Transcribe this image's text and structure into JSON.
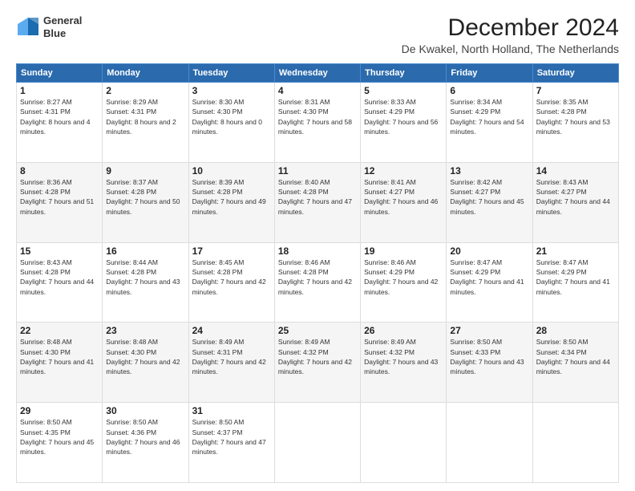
{
  "logo": {
    "line1": "General",
    "line2": "Blue"
  },
  "title": "December 2024",
  "subtitle": "De Kwakel, North Holland, The Netherlands",
  "days_header": [
    "Sunday",
    "Monday",
    "Tuesday",
    "Wednesday",
    "Thursday",
    "Friday",
    "Saturday"
  ],
  "weeks": [
    [
      {
        "day": "1",
        "sunrise": "8:27 AM",
        "sunset": "4:31 PM",
        "daylight": "8 hours and 4 minutes."
      },
      {
        "day": "2",
        "sunrise": "8:29 AM",
        "sunset": "4:31 PM",
        "daylight": "8 hours and 2 minutes."
      },
      {
        "day": "3",
        "sunrise": "8:30 AM",
        "sunset": "4:30 PM",
        "daylight": "8 hours and 0 minutes."
      },
      {
        "day": "4",
        "sunrise": "8:31 AM",
        "sunset": "4:30 PM",
        "daylight": "7 hours and 58 minutes."
      },
      {
        "day": "5",
        "sunrise": "8:33 AM",
        "sunset": "4:29 PM",
        "daylight": "7 hours and 56 minutes."
      },
      {
        "day": "6",
        "sunrise": "8:34 AM",
        "sunset": "4:29 PM",
        "daylight": "7 hours and 54 minutes."
      },
      {
        "day": "7",
        "sunrise": "8:35 AM",
        "sunset": "4:28 PM",
        "daylight": "7 hours and 53 minutes."
      }
    ],
    [
      {
        "day": "8",
        "sunrise": "8:36 AM",
        "sunset": "4:28 PM",
        "daylight": "7 hours and 51 minutes."
      },
      {
        "day": "9",
        "sunrise": "8:37 AM",
        "sunset": "4:28 PM",
        "daylight": "7 hours and 50 minutes."
      },
      {
        "day": "10",
        "sunrise": "8:39 AM",
        "sunset": "4:28 PM",
        "daylight": "7 hours and 49 minutes."
      },
      {
        "day": "11",
        "sunrise": "8:40 AM",
        "sunset": "4:28 PM",
        "daylight": "7 hours and 47 minutes."
      },
      {
        "day": "12",
        "sunrise": "8:41 AM",
        "sunset": "4:27 PM",
        "daylight": "7 hours and 46 minutes."
      },
      {
        "day": "13",
        "sunrise": "8:42 AM",
        "sunset": "4:27 PM",
        "daylight": "7 hours and 45 minutes."
      },
      {
        "day": "14",
        "sunrise": "8:43 AM",
        "sunset": "4:27 PM",
        "daylight": "7 hours and 44 minutes."
      }
    ],
    [
      {
        "day": "15",
        "sunrise": "8:43 AM",
        "sunset": "4:28 PM",
        "daylight": "7 hours and 44 minutes."
      },
      {
        "day": "16",
        "sunrise": "8:44 AM",
        "sunset": "4:28 PM",
        "daylight": "7 hours and 43 minutes."
      },
      {
        "day": "17",
        "sunrise": "8:45 AM",
        "sunset": "4:28 PM",
        "daylight": "7 hours and 42 minutes."
      },
      {
        "day": "18",
        "sunrise": "8:46 AM",
        "sunset": "4:28 PM",
        "daylight": "7 hours and 42 minutes."
      },
      {
        "day": "19",
        "sunrise": "8:46 AM",
        "sunset": "4:29 PM",
        "daylight": "7 hours and 42 minutes."
      },
      {
        "day": "20",
        "sunrise": "8:47 AM",
        "sunset": "4:29 PM",
        "daylight": "7 hours and 41 minutes."
      },
      {
        "day": "21",
        "sunrise": "8:47 AM",
        "sunset": "4:29 PM",
        "daylight": "7 hours and 41 minutes."
      }
    ],
    [
      {
        "day": "22",
        "sunrise": "8:48 AM",
        "sunset": "4:30 PM",
        "daylight": "7 hours and 41 minutes."
      },
      {
        "day": "23",
        "sunrise": "8:48 AM",
        "sunset": "4:30 PM",
        "daylight": "7 hours and 42 minutes."
      },
      {
        "day": "24",
        "sunrise": "8:49 AM",
        "sunset": "4:31 PM",
        "daylight": "7 hours and 42 minutes."
      },
      {
        "day": "25",
        "sunrise": "8:49 AM",
        "sunset": "4:32 PM",
        "daylight": "7 hours and 42 minutes."
      },
      {
        "day": "26",
        "sunrise": "8:49 AM",
        "sunset": "4:32 PM",
        "daylight": "7 hours and 43 minutes."
      },
      {
        "day": "27",
        "sunrise": "8:50 AM",
        "sunset": "4:33 PM",
        "daylight": "7 hours and 43 minutes."
      },
      {
        "day": "28",
        "sunrise": "8:50 AM",
        "sunset": "4:34 PM",
        "daylight": "7 hours and 44 minutes."
      }
    ],
    [
      {
        "day": "29",
        "sunrise": "8:50 AM",
        "sunset": "4:35 PM",
        "daylight": "7 hours and 45 minutes."
      },
      {
        "day": "30",
        "sunrise": "8:50 AM",
        "sunset": "4:36 PM",
        "daylight": "7 hours and 46 minutes."
      },
      {
        "day": "31",
        "sunrise": "8:50 AM",
        "sunset": "4:37 PM",
        "daylight": "7 hours and 47 minutes."
      },
      null,
      null,
      null,
      null
    ]
  ]
}
